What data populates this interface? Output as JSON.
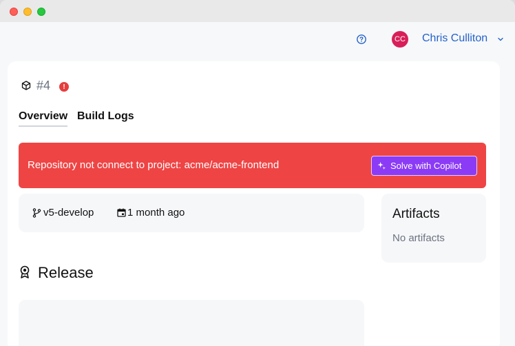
{
  "header": {
    "user_initials": "CC",
    "user_name": "Chris Culliton"
  },
  "build": {
    "number": "#4",
    "status_badge": "!"
  },
  "tabs": [
    {
      "label": "Overview",
      "active": true
    },
    {
      "label": "Build Logs",
      "active": false
    }
  ],
  "alert": {
    "message": "Repository not connect to project: acme/acme-frontend",
    "action_label": "Solve with Copilot"
  },
  "meta": {
    "branch": "v5-develop",
    "time_ago": "1 month ago"
  },
  "artifacts": {
    "title": "Artifacts",
    "empty_text": "No artifacts"
  },
  "release": {
    "title": "Release"
  },
  "colors": {
    "accent": "#2362c9",
    "alert": "#ef4444",
    "copilot": "#8b3bf5",
    "avatar": "#d81f5a"
  },
  "icons": [
    "help-icon",
    "chevron-down-icon",
    "package-icon",
    "branch-icon",
    "calendar-icon",
    "sparkle-icon",
    "award-icon"
  ]
}
